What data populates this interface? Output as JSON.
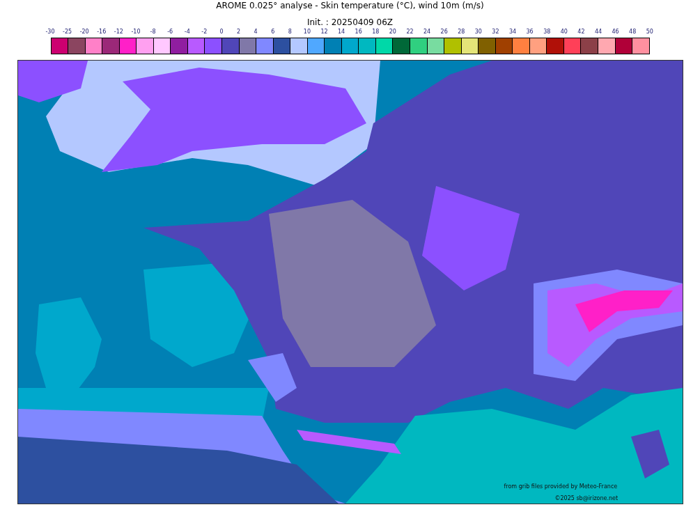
{
  "title": "AROME 0.025° analyse - Skin temperature (°C), wind 10m (m/s)",
  "subtitle": "Init. : 20250409 06Z",
  "legend": {
    "ticks": [
      "-30",
      "-25",
      "-20",
      "-16",
      "-12",
      "-10",
      "-8",
      "-6",
      "-4",
      "-2",
      "0",
      "2",
      "4",
      "6",
      "8",
      "10",
      "12",
      "14",
      "16",
      "18",
      "20",
      "22",
      "24",
      "26",
      "28",
      "30",
      "32",
      "34",
      "36",
      "38",
      "40",
      "42",
      "44",
      "46",
      "48",
      "50"
    ],
    "swatches": [
      {
        "color": "#cc0070"
      },
      {
        "color": "#8b4560"
      },
      {
        "color": "#ff80c8"
      },
      {
        "color": "#9b2878"
      },
      {
        "color": "#ff20c8"
      },
      {
        "color": "#ffa0f0"
      },
      {
        "color": "#ffc8ff"
      },
      {
        "color": "#901ea0"
      },
      {
        "color": "#b85aff"
      },
      {
        "color": "#8c50ff"
      },
      {
        "color": "#5046b8"
      },
      {
        "color": "#8078a8"
      },
      {
        "color": "#8088ff"
      },
      {
        "color": "#2d50a0"
      },
      {
        "color": "#b4c8ff"
      },
      {
        "color": "#50a8ff"
      },
      {
        "color": "#0080b4"
      },
      {
        "color": "#00a8cc"
      },
      {
        "color": "#00b8c0"
      },
      {
        "color": "#00d8a8"
      },
      {
        "color": "#006838"
      },
      {
        "color": "#30d080"
      },
      {
        "color": "#78dca0"
      },
      {
        "color": "#b0c000"
      },
      {
        "color": "#e4e478"
      },
      {
        "color": "#806000"
      },
      {
        "color": "#a04000"
      },
      {
        "color": "#ff8040"
      },
      {
        "color": "#ffa080"
      },
      {
        "color": "#b01008"
      },
      {
        "color": "#ff4058"
      },
      {
        "color": "#8c4048"
      },
      {
        "color": "#ffa8b0"
      },
      {
        "color": "#b00038"
      },
      {
        "color": "#ff90a0"
      }
    ]
  },
  "map": {
    "credits": [
      "from grib files provided by Meteo-France",
      "©2025 sb@irizone.net"
    ]
  }
}
